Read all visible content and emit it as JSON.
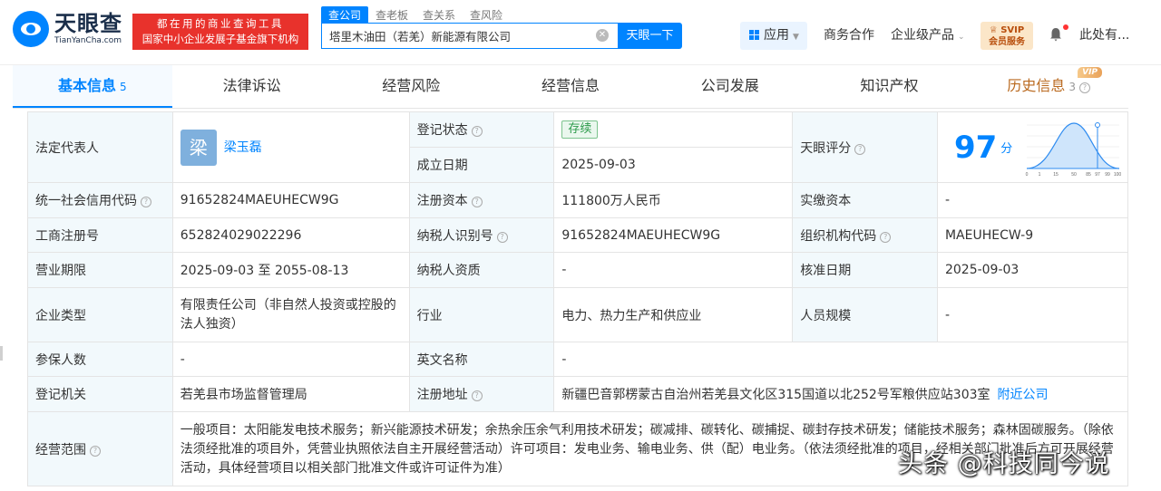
{
  "header": {
    "logo_cn": "天眼查",
    "logo_en": "TianYanCha.com",
    "slogan_line1": "都在用的商业查询工具",
    "slogan_line2": "国家中小企业发展子基金旗下机构",
    "search_tabs": [
      "查公司",
      "查老板",
      "查关系",
      "查风险"
    ],
    "search_value": "塔里木油田（若羌）新能源有限公司",
    "search_button": "天眼一下",
    "apps_label": "应用",
    "nav_business": "商务合作",
    "nav_enterprise": "企业级产品",
    "vip_line1": "SVIP",
    "vip_line2": "会员服务",
    "user_label": "此处有..."
  },
  "tabs": [
    {
      "label": "基本信息",
      "count": "5"
    },
    {
      "label": "法律诉讼"
    },
    {
      "label": "经营风险"
    },
    {
      "label": "经营信息"
    },
    {
      "label": "公司发展"
    },
    {
      "label": "知识产权"
    },
    {
      "label": "历史信息",
      "count": "3",
      "tag": "VIP"
    }
  ],
  "info": {
    "legal_rep_label": "法定代表人",
    "legal_rep_avatar": "梁",
    "legal_rep_name": "梁玉磊",
    "reg_status_label": "登记状态",
    "reg_status_value": "存续",
    "found_date_label": "成立日期",
    "found_date_value": "2025-09-03",
    "score_label": "天眼评分",
    "score_value": "97",
    "score_unit": "分",
    "score_axis": [
      "0",
      "1",
      "15",
      "50",
      "85",
      "97",
      "99",
      "100"
    ],
    "credit_code_label": "统一社会信用代码",
    "credit_code_value": "91652824MAEUHECW9G",
    "reg_capital_label": "注册资本",
    "reg_capital_value": "111800万人民币",
    "paid_capital_label": "实缴资本",
    "paid_capital_value": "-",
    "biz_reg_no_label": "工商注册号",
    "biz_reg_no_value": "652824029022296",
    "taxpayer_id_label": "纳税人识别号",
    "taxpayer_id_value": "91652824MAEUHECW9G",
    "org_code_label": "组织机构代码",
    "org_code_value": "MAEUHECW-9",
    "term_label": "营业期限",
    "term_value": "2025-09-03 至 2055-08-13",
    "taxpayer_qual_label": "纳税人资质",
    "taxpayer_qual_value": "-",
    "approval_date_label": "核准日期",
    "approval_date_value": "2025-09-03",
    "company_type_label": "企业类型",
    "company_type_value": "有限责任公司（非自然人投资或控股的法人独资）",
    "industry_label": "行业",
    "industry_value": "电力、热力生产和供应业",
    "staff_size_label": "人员规模",
    "staff_size_value": "-",
    "insured_label": "参保人数",
    "insured_value": "-",
    "english_name_label": "英文名称",
    "english_name_value": "-",
    "reg_authority_label": "登记机关",
    "reg_authority_value": "若羌县市场监督管理局",
    "reg_address_label": "注册地址",
    "reg_address_value": "新疆巴音郭楞蒙古自治州若羌县文化区315国道以北252号军粮供应站303室",
    "nearby_link": "附近公司",
    "scope_label": "经营范围",
    "scope_value": "一般项目：太阳能发电技术服务；新兴能源技术研发；余热余压余气利用技术研发；碳减排、碳转化、碳捕捉、碳封存技术研发；储能技术服务；森林固碳服务。（除依法须经批准的项目外，凭营业执照依法自主开展经营活动）许可项目：发电业务、输电业务、供（配）电业务。（依法须经批准的项目，经相关部门批准后方可开展经营活动，具体经营项目以相关部门批准文件或许可证件为准）"
  },
  "watermark": "头条 @科技同今说"
}
